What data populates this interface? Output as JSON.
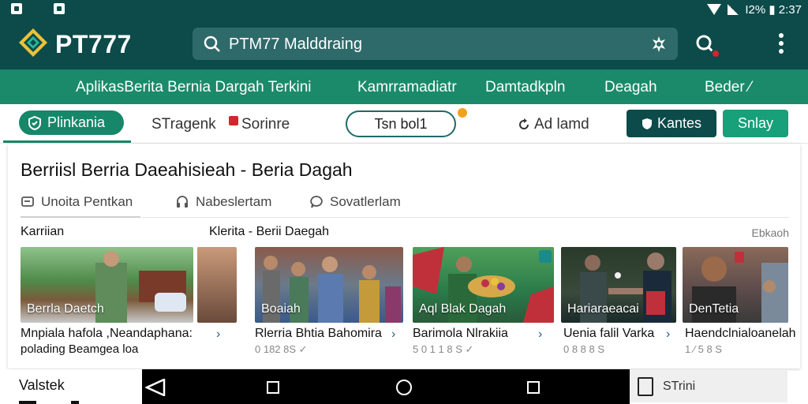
{
  "status_bar": {
    "right_text": "I2% ▮ 2:37"
  },
  "app_bar": {
    "brand_name": "PT777",
    "search_text": "PTM77 Malddraing",
    "icons": [
      "logo-icon",
      "search-icon",
      "settings-icon",
      "profile-search-icon",
      "more-vert-icon"
    ]
  },
  "nav": {
    "items": [
      "AplikasBerita Bernia Dargah Terkini",
      "Kamrramadiatr",
      "Damtadkpln",
      "Deagah",
      "Beder ⁄"
    ]
  },
  "toolbar": {
    "active_pill": "Plinkania",
    "link1": "STragenk",
    "link2": "Sorinre",
    "outline_pill": "Tsn bol1",
    "link3": "Ad lamd",
    "dark_button": "Kantes",
    "green_button": "Snlay"
  },
  "card": {
    "title": "Berriisl Berria Daeahisieah - Beria Dagah",
    "tabs": [
      "Unoita Pentkan",
      "Nabeslertam",
      "Sovatlerlam"
    ],
    "section_left": "Karriian",
    "section_mid": "Klerita - Berii Daegah",
    "section_right": "Ebkaoh",
    "items": [
      {
        "caption": "Berrla Daetch",
        "title": "Mnpiala hafola ,Neandaphana:",
        "sub": "polading Beamgea loa",
        "count": ""
      },
      {
        "caption": "Boaiah",
        "title": "Rlerria Bhtia Bahomira",
        "sub": "",
        "count": "0 182 8S ✓"
      },
      {
        "caption": "Aql Blak Dagah",
        "title": "Barimola Nlrakiia",
        "sub": "",
        "count": "5 0 1 1 8 S ✓"
      },
      {
        "caption": "Hariaraeacai",
        "title": "Uenia falil Varka",
        "sub": "",
        "count": "0 8 8 8 S"
      },
      {
        "caption": "DenTetia",
        "title": "Haendclnialoanelah",
        "sub": "",
        "count": "1 ⁄ 5 8 S"
      }
    ]
  },
  "bottom": {
    "left_label": "Valstek",
    "right_label": "STrini"
  },
  "colors": {
    "primary_dark": "#0d4a4a",
    "nav_green": "#1a8a6a",
    "accent_green": "#17876a",
    "brand_gold": "#e8c23a",
    "alert_red": "#d0262c",
    "badge_orange": "#f0a21a"
  }
}
